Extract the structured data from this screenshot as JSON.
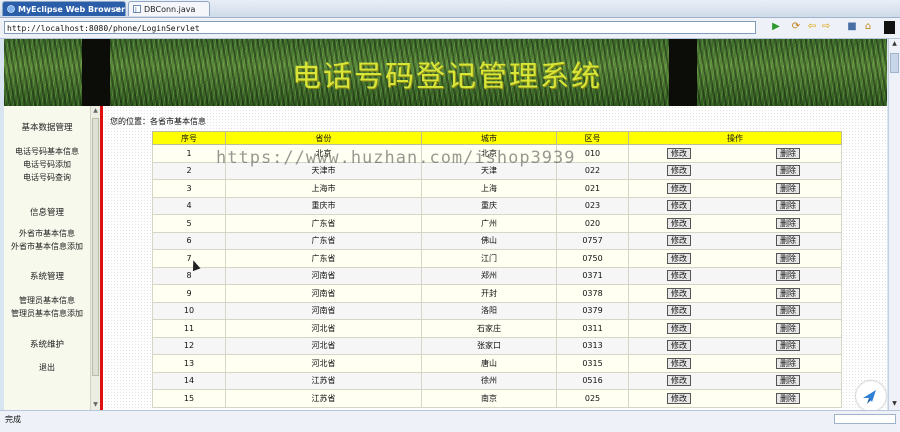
{
  "tabs": [
    {
      "label": "MyEclipse Web Browser",
      "active": true,
      "close": "✕"
    },
    {
      "label": "DBConn.java",
      "active": false
    }
  ],
  "address": {
    "url": "http://localhost:8080/phone/LoginServlet"
  },
  "toolbar_icons": [
    "go-icon",
    "refresh-icon",
    "back-icon",
    "forward-icon",
    "stop-icon",
    "home-icon"
  ],
  "banner": {
    "title": "电话号码登记管理系统"
  },
  "sidebar": {
    "sections": [
      {
        "heading": "基本数据管理",
        "items": [
          "电话号码基本信息",
          "电话号码添加",
          "电话号码查询"
        ]
      },
      {
        "heading": "信息管理",
        "items": [
          "外省市基本信息",
          "外省市基本信息添加"
        ]
      },
      {
        "heading": "系统管理",
        "items": [
          "管理员基本信息",
          "管理员基本信息添加"
        ]
      },
      {
        "heading": "系统维护",
        "items": [
          "退出"
        ]
      }
    ]
  },
  "main": {
    "breadcrumb": "您的位置：各省市基本信息",
    "columns": [
      "序号",
      "省份",
      "城市",
      "区号",
      "操作"
    ],
    "edit_label": "修改",
    "delete_label": "删除",
    "rows": [
      {
        "no": "1",
        "province": "北京",
        "city": "北京",
        "code": "010"
      },
      {
        "no": "2",
        "province": "天津市",
        "city": "天津",
        "code": "022"
      },
      {
        "no": "3",
        "province": "上海市",
        "city": "上海",
        "code": "021"
      },
      {
        "no": "4",
        "province": "重庆市",
        "city": "重庆",
        "code": "023"
      },
      {
        "no": "5",
        "province": "广东省",
        "city": "广州",
        "code": "020"
      },
      {
        "no": "6",
        "province": "广东省",
        "city": "佛山",
        "code": "0757"
      },
      {
        "no": "7",
        "province": "广东省",
        "city": "江门",
        "code": "0750"
      },
      {
        "no": "8",
        "province": "河南省",
        "city": "郑州",
        "code": "0371"
      },
      {
        "no": "9",
        "province": "河南省",
        "city": "开封",
        "code": "0378"
      },
      {
        "no": "10",
        "province": "河南省",
        "city": "洛阳",
        "code": "0379"
      },
      {
        "no": "11",
        "province": "河北省",
        "city": "石家庄",
        "code": "0311"
      },
      {
        "no": "12",
        "province": "河北省",
        "city": "张家口",
        "code": "0313"
      },
      {
        "no": "13",
        "province": "河北省",
        "city": "唐山",
        "code": "0315"
      },
      {
        "no": "14",
        "province": "江苏省",
        "city": "徐州",
        "code": "0516"
      },
      {
        "no": "15",
        "province": "江苏省",
        "city": "南京",
        "code": "025"
      }
    ]
  },
  "watermark": "https://www.huzhan.com/ishop3939",
  "status": {
    "text": "完成"
  }
}
